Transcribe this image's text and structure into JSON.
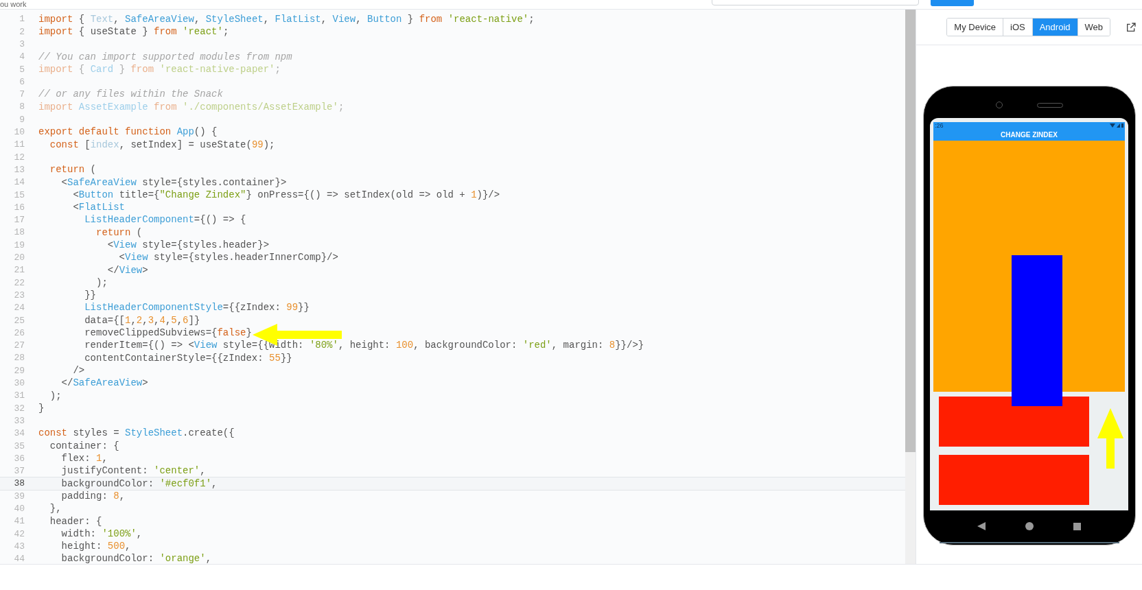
{
  "top_bar": {
    "caption": "ou work"
  },
  "editor": {
    "lines": [
      {
        "number": "1",
        "active": false,
        "tokens": [
          {
            "kind": "kw",
            "text": "import"
          },
          {
            "kind": "text",
            "text": " { "
          },
          {
            "kind": "unused",
            "text": "Text"
          },
          {
            "kind": "text",
            "text": ", "
          },
          {
            "kind": "type",
            "text": "SafeAreaView"
          },
          {
            "kind": "text",
            "text": ", "
          },
          {
            "kind": "type",
            "text": "StyleSheet"
          },
          {
            "kind": "text",
            "text": ", "
          },
          {
            "kind": "type",
            "text": "FlatList"
          },
          {
            "kind": "text",
            "text": ", "
          },
          {
            "kind": "type",
            "text": "View"
          },
          {
            "kind": "text",
            "text": ", "
          },
          {
            "kind": "type",
            "text": "Button"
          },
          {
            "kind": "text",
            "text": " } "
          },
          {
            "kind": "kw",
            "text": "from"
          },
          {
            "kind": "str",
            "text": " 'react-native'"
          },
          {
            "kind": "text",
            "text": ";"
          }
        ]
      },
      {
        "number": "2",
        "active": false,
        "tokens": [
          {
            "kind": "kw",
            "text": "import"
          },
          {
            "kind": "text",
            "text": " { useState } "
          },
          {
            "kind": "kw",
            "text": "from"
          },
          {
            "kind": "str",
            "text": " 'react'"
          },
          {
            "kind": "text",
            "text": ";"
          }
        ]
      },
      {
        "number": "3",
        "active": false
      },
      {
        "number": "4",
        "active": false,
        "tokens": [
          {
            "kind": "comment",
            "text": "// You can import supported modules from npm"
          }
        ]
      },
      {
        "number": "5",
        "active": false,
        "tokens": [
          {
            "kind": "fkw",
            "text": "import"
          },
          {
            "kind": "ftext",
            "text": " { "
          },
          {
            "kind": "ftype",
            "text": "Card"
          },
          {
            "kind": "ftext",
            "text": " } "
          },
          {
            "kind": "fkw",
            "text": "from"
          },
          {
            "kind": "fstr",
            "text": " 'react-native-paper'"
          },
          {
            "kind": "ftext",
            "text": ";"
          }
        ]
      },
      {
        "number": "6",
        "active": false
      },
      {
        "number": "7",
        "active": false,
        "tokens": [
          {
            "kind": "comment",
            "text": "// or any files within the Snack"
          }
        ]
      },
      {
        "number": "8",
        "active": false,
        "tokens": [
          {
            "kind": "fkw",
            "text": "import"
          },
          {
            "kind": "ftype",
            "text": " AssetExample"
          },
          {
            "kind": "fkw",
            "text": " from"
          },
          {
            "kind": "fstr",
            "text": " './components/AssetExample'"
          },
          {
            "kind": "ftext",
            "text": ";"
          }
        ]
      },
      {
        "number": "9",
        "active": false
      },
      {
        "number": "10",
        "active": false,
        "tokens": [
          {
            "kind": "kw",
            "text": "export default function"
          },
          {
            "kind": "type",
            "text": " App"
          },
          {
            "kind": "text",
            "text": "() {"
          }
        ]
      },
      {
        "number": "11",
        "active": false,
        "tokens": [
          {
            "kind": "kw",
            "text": "  const"
          },
          {
            "kind": "text",
            "text": " ["
          },
          {
            "kind": "unused",
            "text": "index"
          },
          {
            "kind": "text",
            "text": ", setIndex] = useState("
          },
          {
            "kind": "num",
            "text": "99"
          },
          {
            "kind": "text",
            "text": ");"
          }
        ]
      },
      {
        "number": "12",
        "active": false
      },
      {
        "number": "13",
        "active": false,
        "tokens": [
          {
            "kind": "kw",
            "text": "  return"
          },
          {
            "kind": "text",
            "text": " ("
          }
        ]
      },
      {
        "number": "14",
        "active": false,
        "tokens": [
          {
            "kind": "text",
            "text": "    <"
          },
          {
            "kind": "type",
            "text": "SafeAreaView"
          },
          {
            "kind": "text",
            "text": " style={styles.container}>"
          }
        ]
      },
      {
        "number": "15",
        "active": false,
        "tokens": [
          {
            "kind": "text",
            "text": "      <"
          },
          {
            "kind": "type",
            "text": "Button"
          },
          {
            "kind": "text",
            "text": " title={"
          },
          {
            "kind": "str",
            "text": "\"Change Zindex\""
          },
          {
            "kind": "text",
            "text": "} onPress={() => setIndex(old => old + "
          },
          {
            "kind": "num",
            "text": "1"
          },
          {
            "kind": "text",
            "text": ")}/>"
          }
        ]
      },
      {
        "number": "16",
        "active": false,
        "tokens": [
          {
            "kind": "text",
            "text": "      <"
          },
          {
            "kind": "type",
            "text": "FlatList"
          }
        ]
      },
      {
        "number": "17",
        "active": false,
        "tokens": [
          {
            "kind": "type",
            "text": "        ListHeaderComponent"
          },
          {
            "kind": "text",
            "text": "={() => {"
          }
        ]
      },
      {
        "number": "18",
        "active": false,
        "tokens": [
          {
            "kind": "kw",
            "text": "          return"
          },
          {
            "kind": "text",
            "text": " ("
          }
        ]
      },
      {
        "number": "19",
        "active": false,
        "tokens": [
          {
            "kind": "text",
            "text": "            <"
          },
          {
            "kind": "type",
            "text": "View"
          },
          {
            "kind": "text",
            "text": " style={styles.header}>"
          }
        ]
      },
      {
        "number": "20",
        "active": false,
        "tokens": [
          {
            "kind": "text",
            "text": "              <"
          },
          {
            "kind": "type",
            "text": "View"
          },
          {
            "kind": "text",
            "text": " style={styles.headerInnerComp}/>"
          }
        ]
      },
      {
        "number": "21",
        "active": false,
        "tokens": [
          {
            "kind": "text",
            "text": "            </"
          },
          {
            "kind": "type",
            "text": "View"
          },
          {
            "kind": "text",
            "text": ">"
          }
        ]
      },
      {
        "number": "22",
        "active": false,
        "tokens": [
          {
            "kind": "text",
            "text": "          );"
          }
        ]
      },
      {
        "number": "23",
        "active": false,
        "tokens": [
          {
            "kind": "text",
            "text": "        }}"
          }
        ]
      },
      {
        "number": "24",
        "active": false,
        "tokens": [
          {
            "kind": "type",
            "text": "        ListHeaderComponentStyle"
          },
          {
            "kind": "text",
            "text": "={{zIndex: "
          },
          {
            "kind": "num",
            "text": "99"
          },
          {
            "kind": "text",
            "text": "}}"
          }
        ]
      },
      {
        "number": "25",
        "active": false,
        "tokens": [
          {
            "kind": "text",
            "text": "        data={["
          },
          {
            "kind": "num",
            "text": "1"
          },
          {
            "kind": "text",
            "text": ","
          },
          {
            "kind": "num",
            "text": "2"
          },
          {
            "kind": "text",
            "text": ","
          },
          {
            "kind": "num",
            "text": "3"
          },
          {
            "kind": "text",
            "text": ","
          },
          {
            "kind": "num",
            "text": "4"
          },
          {
            "kind": "text",
            "text": ","
          },
          {
            "kind": "num",
            "text": "5"
          },
          {
            "kind": "text",
            "text": ","
          },
          {
            "kind": "num",
            "text": "6"
          },
          {
            "kind": "text",
            "text": "]}"
          }
        ]
      },
      {
        "number": "26",
        "active": false,
        "tokens": [
          {
            "kind": "text",
            "text": "        removeClippedSubviews={"
          },
          {
            "kind": "kw",
            "text": "false"
          },
          {
            "kind": "text",
            "text": "}"
          }
        ]
      },
      {
        "number": "27",
        "active": false,
        "tokens": [
          {
            "kind": "text",
            "text": "        renderItem={() => <"
          },
          {
            "kind": "type",
            "text": "View"
          },
          {
            "kind": "text",
            "text": " style={{width: "
          },
          {
            "kind": "str",
            "text": "'80%'"
          },
          {
            "kind": "text",
            "text": ", height: "
          },
          {
            "kind": "num",
            "text": "100"
          },
          {
            "kind": "text",
            "text": ", backgroundColor: "
          },
          {
            "kind": "str",
            "text": "'red'"
          },
          {
            "kind": "text",
            "text": ", margin: "
          },
          {
            "kind": "num",
            "text": "8"
          },
          {
            "kind": "text",
            "text": "}}/>}"
          }
        ]
      },
      {
        "number": "28",
        "active": false,
        "tokens": [
          {
            "kind": "text",
            "text": "        contentContainerStyle={{zIndex: "
          },
          {
            "kind": "num",
            "text": "55"
          },
          {
            "kind": "text",
            "text": "}}"
          }
        ]
      },
      {
        "number": "29",
        "active": false,
        "tokens": [
          {
            "kind": "text",
            "text": "      />"
          }
        ]
      },
      {
        "number": "30",
        "active": false,
        "tokens": [
          {
            "kind": "text",
            "text": "    </"
          },
          {
            "kind": "type",
            "text": "SafeAreaView"
          },
          {
            "kind": "text",
            "text": ">"
          }
        ]
      },
      {
        "number": "31",
        "active": false,
        "tokens": [
          {
            "kind": "text",
            "text": "  );"
          }
        ]
      },
      {
        "number": "32",
        "active": false,
        "tokens": [
          {
            "kind": "text",
            "text": "}"
          }
        ]
      },
      {
        "number": "33",
        "active": false
      },
      {
        "number": "34",
        "active": false,
        "tokens": [
          {
            "kind": "kw",
            "text": "const"
          },
          {
            "kind": "text",
            "text": " styles = "
          },
          {
            "kind": "type",
            "text": "StyleSheet"
          },
          {
            "kind": "text",
            "text": ".create({"
          }
        ]
      },
      {
        "number": "35",
        "active": false,
        "tokens": [
          {
            "kind": "text",
            "text": "  container: {"
          }
        ]
      },
      {
        "number": "36",
        "active": false,
        "tokens": [
          {
            "kind": "text",
            "text": "    flex: "
          },
          {
            "kind": "num",
            "text": "1"
          },
          {
            "kind": "text",
            "text": ","
          }
        ]
      },
      {
        "number": "37",
        "active": false,
        "tokens": [
          {
            "kind": "text",
            "text": "    justifyContent: "
          },
          {
            "kind": "str",
            "text": "'center'"
          },
          {
            "kind": "text",
            "text": ","
          }
        ]
      },
      {
        "number": "38",
        "active": true,
        "tokens": [
          {
            "kind": "text",
            "text": "    backgroundColor: "
          },
          {
            "kind": "str",
            "text": "'#ecf0f1'"
          },
          {
            "kind": "text",
            "text": ","
          }
        ]
      },
      {
        "number": "39",
        "active": false,
        "tokens": [
          {
            "kind": "text",
            "text": "    padding: "
          },
          {
            "kind": "num",
            "text": "8"
          },
          {
            "kind": "text",
            "text": ","
          }
        ]
      },
      {
        "number": "40",
        "active": false,
        "tokens": [
          {
            "kind": "text",
            "text": "  },"
          }
        ]
      },
      {
        "number": "41",
        "active": false,
        "tokens": [
          {
            "kind": "text",
            "text": "  header: {"
          }
        ]
      },
      {
        "number": "42",
        "active": false,
        "tokens": [
          {
            "kind": "text",
            "text": "    width: "
          },
          {
            "kind": "str",
            "text": "'100%'"
          },
          {
            "kind": "text",
            "text": ","
          }
        ]
      },
      {
        "number": "43",
        "active": false,
        "tokens": [
          {
            "kind": "text",
            "text": "    height: "
          },
          {
            "kind": "num",
            "text": "500"
          },
          {
            "kind": "text",
            "text": ","
          }
        ]
      },
      {
        "number": "44",
        "active": false,
        "tokens": [
          {
            "kind": "text",
            "text": "    backgroundColor: "
          },
          {
            "kind": "str",
            "text": "'orange'"
          },
          {
            "kind": "text",
            "text": ","
          }
        ]
      }
    ]
  },
  "preview": {
    "device_tabs": [
      {
        "label": "My Device",
        "selected": false
      },
      {
        "label": "iOS",
        "selected": false
      },
      {
        "label": "Android",
        "selected": true
      },
      {
        "label": "Web",
        "selected": false
      }
    ],
    "phone": {
      "status_time": ":26",
      "button": "CHANGE ZINDEX"
    }
  }
}
